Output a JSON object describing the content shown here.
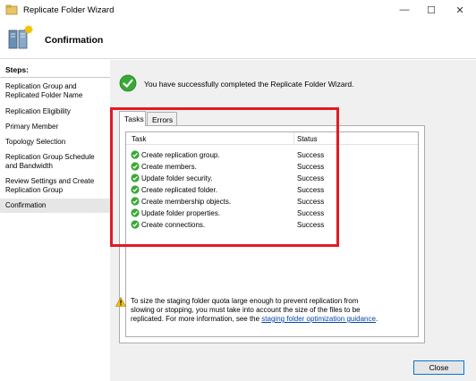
{
  "window": {
    "title": "Replicate Folder Wizard",
    "controls": {
      "minimize": "—",
      "maximize": "☐",
      "close": "✕"
    }
  },
  "header": {
    "title": "Confirmation"
  },
  "sidebar": {
    "label": "Steps:",
    "items": [
      {
        "label": "Replication Group and Replicated Folder Name"
      },
      {
        "label": "Replication Eligibility"
      },
      {
        "label": "Primary Member"
      },
      {
        "label": "Topology Selection"
      },
      {
        "label": "Replication Group Schedule and Bandwidth"
      },
      {
        "label": "Review Settings and Create Replication Group"
      },
      {
        "label": "Confirmation"
      }
    ]
  },
  "main": {
    "success_message": "You have successfully completed the Replicate Folder Wizard.",
    "tabs": [
      {
        "label": "Tasks"
      },
      {
        "label": "Errors"
      }
    ],
    "columns": {
      "task": "Task",
      "status": "Status"
    },
    "rows": [
      {
        "task": "Create replication group.",
        "status": "Success"
      },
      {
        "task": "Create members.",
        "status": "Success"
      },
      {
        "task": "Update folder security.",
        "status": "Success"
      },
      {
        "task": "Create replicated folder.",
        "status": "Success"
      },
      {
        "task": "Create membership objects.",
        "status": "Success"
      },
      {
        "task": "Update folder properties.",
        "status": "Success"
      },
      {
        "task": "Create connections.",
        "status": "Success"
      }
    ],
    "warning": {
      "text": "To size the staging folder quota large enough to prevent replication from slowing or stopping, you must take into account the size of the files to be replicated. For more information, see the ",
      "link": "staging folder optimization guidance",
      "suffix": "."
    },
    "close_label": "Close"
  },
  "colors": {
    "accent": "#0078d7",
    "highlight": "#e01b24",
    "success": "#3aa835",
    "link": "#0645ad"
  }
}
